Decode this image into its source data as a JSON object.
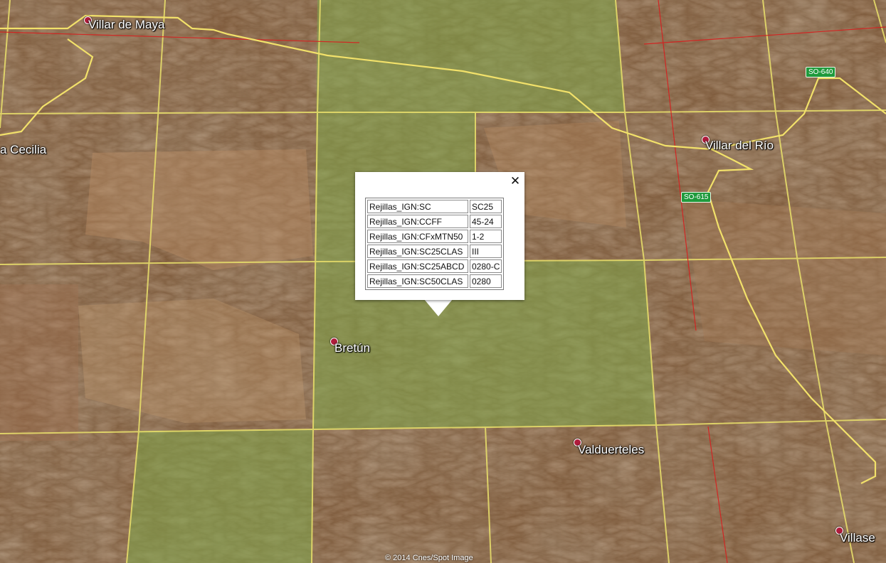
{
  "places": [
    {
      "id": "villar-de-maya",
      "name": "Villar de Maya"
    },
    {
      "id": "santa-cecilia",
      "name": "a Cecilia"
    },
    {
      "id": "villar-del-rio",
      "name": "Villar del Río"
    },
    {
      "id": "bretun",
      "name": "Bretún"
    },
    {
      "id": "valduerteles",
      "name": "Valduerteles"
    },
    {
      "id": "villase",
      "name": "Villase"
    }
  ],
  "roads": [
    {
      "id": "so-640",
      "label": "SO-640"
    },
    {
      "id": "so-615",
      "label": "SO-615"
    }
  ],
  "balloon": {
    "rows": [
      {
        "key": "Rejillas_IGN:SC",
        "value": "SC25"
      },
      {
        "key": "Rejillas_IGN:CCFF",
        "value": "45-24"
      },
      {
        "key": "Rejillas_IGN:CFxMTN50",
        "value": "1-2"
      },
      {
        "key": "Rejillas_IGN:SC25CLAS",
        "value": "III"
      },
      {
        "key": "Rejillas_IGN:SC25ABCD",
        "value": "0280-C"
      },
      {
        "key": "Rejillas_IGN:SC50CLAS",
        "value": "0280"
      }
    ],
    "close_icon": "close-icon"
  },
  "copyright": "© 2014 Cnes/Spot Image",
  "colors": {
    "grid_line": "#e6dc6a",
    "road": "#f2e16a",
    "boundary": "#d81e1e",
    "highlight_cell": "#7fa74a",
    "terrain": "#7a5535"
  }
}
